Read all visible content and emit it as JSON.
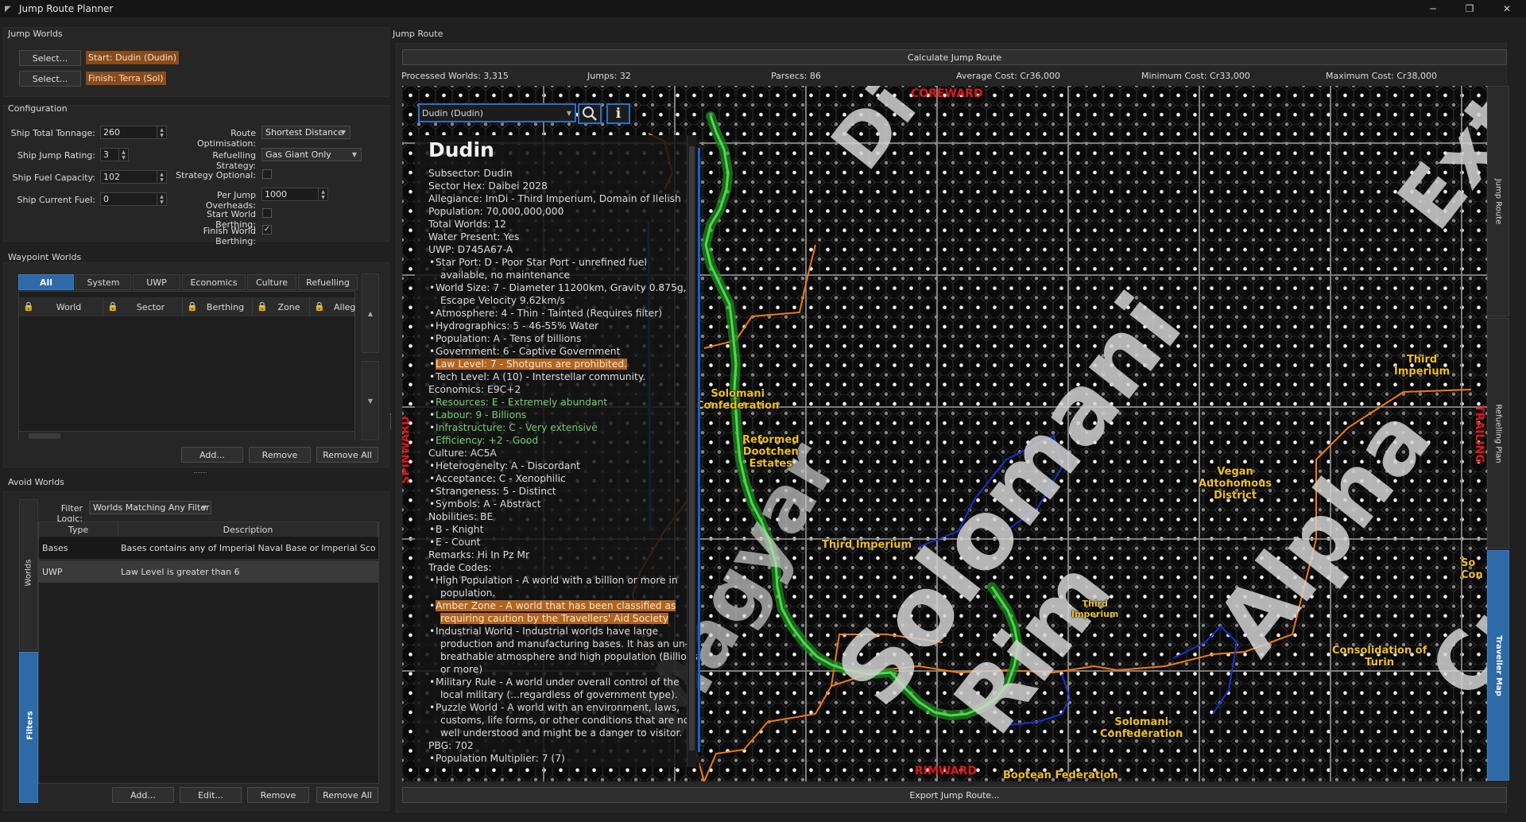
{
  "window": {
    "title": "Jump Route Planner",
    "minimize": "─",
    "restore": "❐",
    "close": "✕"
  },
  "jump_worlds": {
    "title": "Jump Worlds",
    "select_label": "Select...",
    "start": "Start: Dudin (Dudin)",
    "finish": "Finish: Terra (Sol)"
  },
  "config": {
    "title": "Configuration",
    "tonnage_label": "Ship Total Tonnage:",
    "tonnage": "260",
    "jump_label": "Ship Jump Rating:",
    "jump": "3",
    "fuel_cap_label": "Ship Fuel Capacity:",
    "fuel_cap": "102",
    "fuel_cur_label": "Ship Current Fuel:",
    "fuel_cur": "0",
    "route_opt_label": "Route Optimisation:",
    "route_opt": "Shortest Distance",
    "refuel_label": "Refuelling Strategy:",
    "refuel": "Gas Giant Only",
    "strategy_opt_label": "Strategy Optional:",
    "overheads_label": "Per Jump Overheads:",
    "overheads": "1000",
    "start_berth_label": "Start World Berthing:",
    "finish_berth_label": "Finish World Berthing:",
    "check_mark": "✓"
  },
  "waypoints": {
    "title": "Waypoint Worlds",
    "tabs": [
      "All",
      "System",
      "UWP",
      "Economics",
      "Culture",
      "Refuelling"
    ],
    "columns": [
      "World",
      "Sector",
      "Berthing",
      "Zone",
      "Alleg"
    ],
    "add": "Add...",
    "remove": "Remove",
    "remove_all": "Remove All"
  },
  "avoid": {
    "title": "Avoid Worlds",
    "filter_logic_label": "Filter Logic:",
    "filter_logic": "Worlds Matching Any Filter",
    "columns": [
      "Type",
      "Description"
    ],
    "rows": [
      {
        "type": "Bases",
        "desc": "Bases contains any of Imperial Naval Base or Imperial Scou..."
      },
      {
        "type": "UWP",
        "desc": "Law Level is greater than 6"
      }
    ],
    "side_tabs": [
      "Worlds",
      "Filters"
    ],
    "add": "Add...",
    "edit": "Edit...",
    "remove": "Remove",
    "remove_all": "Remove All"
  },
  "route": {
    "title": "Jump Route",
    "calculate": "Calculate Jump Route",
    "export": "Export Jump Route...",
    "stats": {
      "processed": "Processed Worlds: 3,315",
      "jumps": "Jumps: 32",
      "parsecs": "Parsecs: 86",
      "avg": "Average Cost: Cr36,000",
      "min": "Minimum Cost: Cr33,000",
      "max": "Maximum Cost: Cr38,000"
    },
    "search_value": "Dudin (Dudin)",
    "side_tabs": [
      "Jump Route",
      "Refuelling Plan",
      "Traveller Map"
    ]
  },
  "map": {
    "sectors": [
      {
        "name": "Solomani",
        "cls": "s1"
      },
      {
        "name": "Rim",
        "cls": "s2"
      },
      {
        "name": "Magyar",
        "cls": "s3"
      },
      {
        "name": "Alpha",
        "cls": "s4"
      },
      {
        "name": "Cr",
        "cls": "s5"
      },
      {
        "name": "Ext",
        "cls": "s6"
      },
      {
        "name": "Di",
        "cls": "s7"
      }
    ],
    "directions": {
      "coreward": "COREWARD",
      "rimward": "RIMWARD",
      "spinward": "SPINWARD",
      "trailing": "TRAILING"
    },
    "polities": [
      {
        "text": "Solomani\nConfederation",
        "cls": "p1"
      },
      {
        "text": "Reformed\nDootchen\nEstates",
        "cls": "p2"
      },
      {
        "text": "Third Imperium",
        "cls": "p3"
      },
      {
        "text": "Vegan\nAutonomous\nDistrict",
        "cls": "p4"
      },
      {
        "text": "Third\nImperium",
        "cls": "p5"
      },
      {
        "text": "Third\nImperium",
        "cls": "p6"
      },
      {
        "text": "Solomani\nConfederation",
        "cls": "p7"
      },
      {
        "text": "Bootean Federation",
        "cls": "p8"
      },
      {
        "text": "Consolidation of\nTurin",
        "cls": "p9"
      },
      {
        "text": "So\nCon",
        "cls": "p10"
      }
    ]
  },
  "world_info": {
    "name": "Dudin",
    "lines": [
      {
        "t": "Subsector: Dudin",
        "k": "ln"
      },
      {
        "t": "Sector Hex: Daibei 2028",
        "k": "ln"
      },
      {
        "t": "Allegiance: ImDi - Third Imperium, Domain of Ilelish",
        "k": "ln"
      },
      {
        "t": "Population: 70,000,000,000",
        "k": "ln"
      },
      {
        "t": "Total Worlds: 12",
        "k": "ln"
      },
      {
        "t": "Water Present: Yes",
        "k": "ln"
      },
      {
        "t": "UWP: D745A67-A",
        "k": "ln"
      },
      {
        "t": "Star Port: D - Poor Star Port - unrefined fuel",
        "k": "b"
      },
      {
        "t": "available, no maintenance",
        "k": "b2"
      },
      {
        "t": "World Size: 7 - Diameter 11200km, Gravity 0.875g,",
        "k": "b"
      },
      {
        "t": "Escape Velocity 9.62km/s",
        "k": "b2"
      },
      {
        "t": "Atmosphere: 4 - Thin - Tainted (Requires filter)",
        "k": "b"
      },
      {
        "t": "Hydrographics: 5 - 46-55% Water",
        "k": "b"
      },
      {
        "t": "Population: A - Tens of billions",
        "k": "b"
      },
      {
        "t": "Government: 6 - Captive Government",
        "k": "b"
      },
      {
        "t": "Law Level: 7 - Shotguns are prohibited.",
        "k": "b",
        "h": "o"
      },
      {
        "t": "Tech Level: A (10) - Interstellar community.",
        "k": "b"
      },
      {
        "t": "Economics: E9C+2",
        "k": "ln"
      },
      {
        "t": "Resources: E - Extremely abundant",
        "k": "b",
        "h": "g"
      },
      {
        "t": "Labour: 9 - Billions",
        "k": "b",
        "h": "g"
      },
      {
        "t": "Infrastructure: C - Very extensive",
        "k": "b",
        "h": "g"
      },
      {
        "t": "Efficiency: +2 - Good",
        "k": "b",
        "h": "g"
      },
      {
        "t": "Culture: AC5A",
        "k": "ln"
      },
      {
        "t": "Heterogeneity: A - Discordant",
        "k": "b"
      },
      {
        "t": "Acceptance: C - Xenophilic",
        "k": "b"
      },
      {
        "t": "Strangeness: 5 - Distinct",
        "k": "b"
      },
      {
        "t": "Symbols: A - Abstract",
        "k": "b"
      },
      {
        "t": "Nobilities: BE",
        "k": "ln"
      },
      {
        "t": "B - Knight",
        "k": "b"
      },
      {
        "t": "E - Count",
        "k": "b"
      },
      {
        "t": "Remarks: Hi In Pz Mr",
        "k": "ln"
      },
      {
        "t": "Trade Codes:",
        "k": "ln"
      },
      {
        "t": "High Population - A world with a billion or more in",
        "k": "b"
      },
      {
        "t": "population.",
        "k": "b2"
      },
      {
        "t": "Amber Zone - A world that has been classified as",
        "k": "b",
        "h": "o"
      },
      {
        "t": "requiring caution by the Travellers' Aid Society",
        "k": "b2",
        "h": "o"
      },
      {
        "t": "Industrial World - Industrial worlds have large",
        "k": "b"
      },
      {
        "t": "production and manufacturing bases. It has an un-",
        "k": "b2"
      },
      {
        "t": "breathable atmosphere and high population (Billions",
        "k": "b2"
      },
      {
        "t": "or more)",
        "k": "b2"
      },
      {
        "t": "Military Rule - A world under overall control of the",
        "k": "b"
      },
      {
        "t": "local military (...regardless of government type).",
        "k": "b2"
      },
      {
        "t": "Puzzle World - A world with an environment, laws,",
        "k": "b"
      },
      {
        "t": "customs, life forms, or other conditions that are not",
        "k": "b2"
      },
      {
        "t": "well understood and might be a danger to visitor.",
        "k": "b2"
      },
      {
        "t": "PBG: 702",
        "k": "ln"
      },
      {
        "t": "Population Multiplier: 7 (7)",
        "k": "b"
      }
    ]
  },
  "colors": {
    "accent": "#2e69a8",
    "route": "#2fb52f",
    "highlight": "#b06420",
    "polity_label": "#f0c020",
    "direction": "#e01818"
  }
}
